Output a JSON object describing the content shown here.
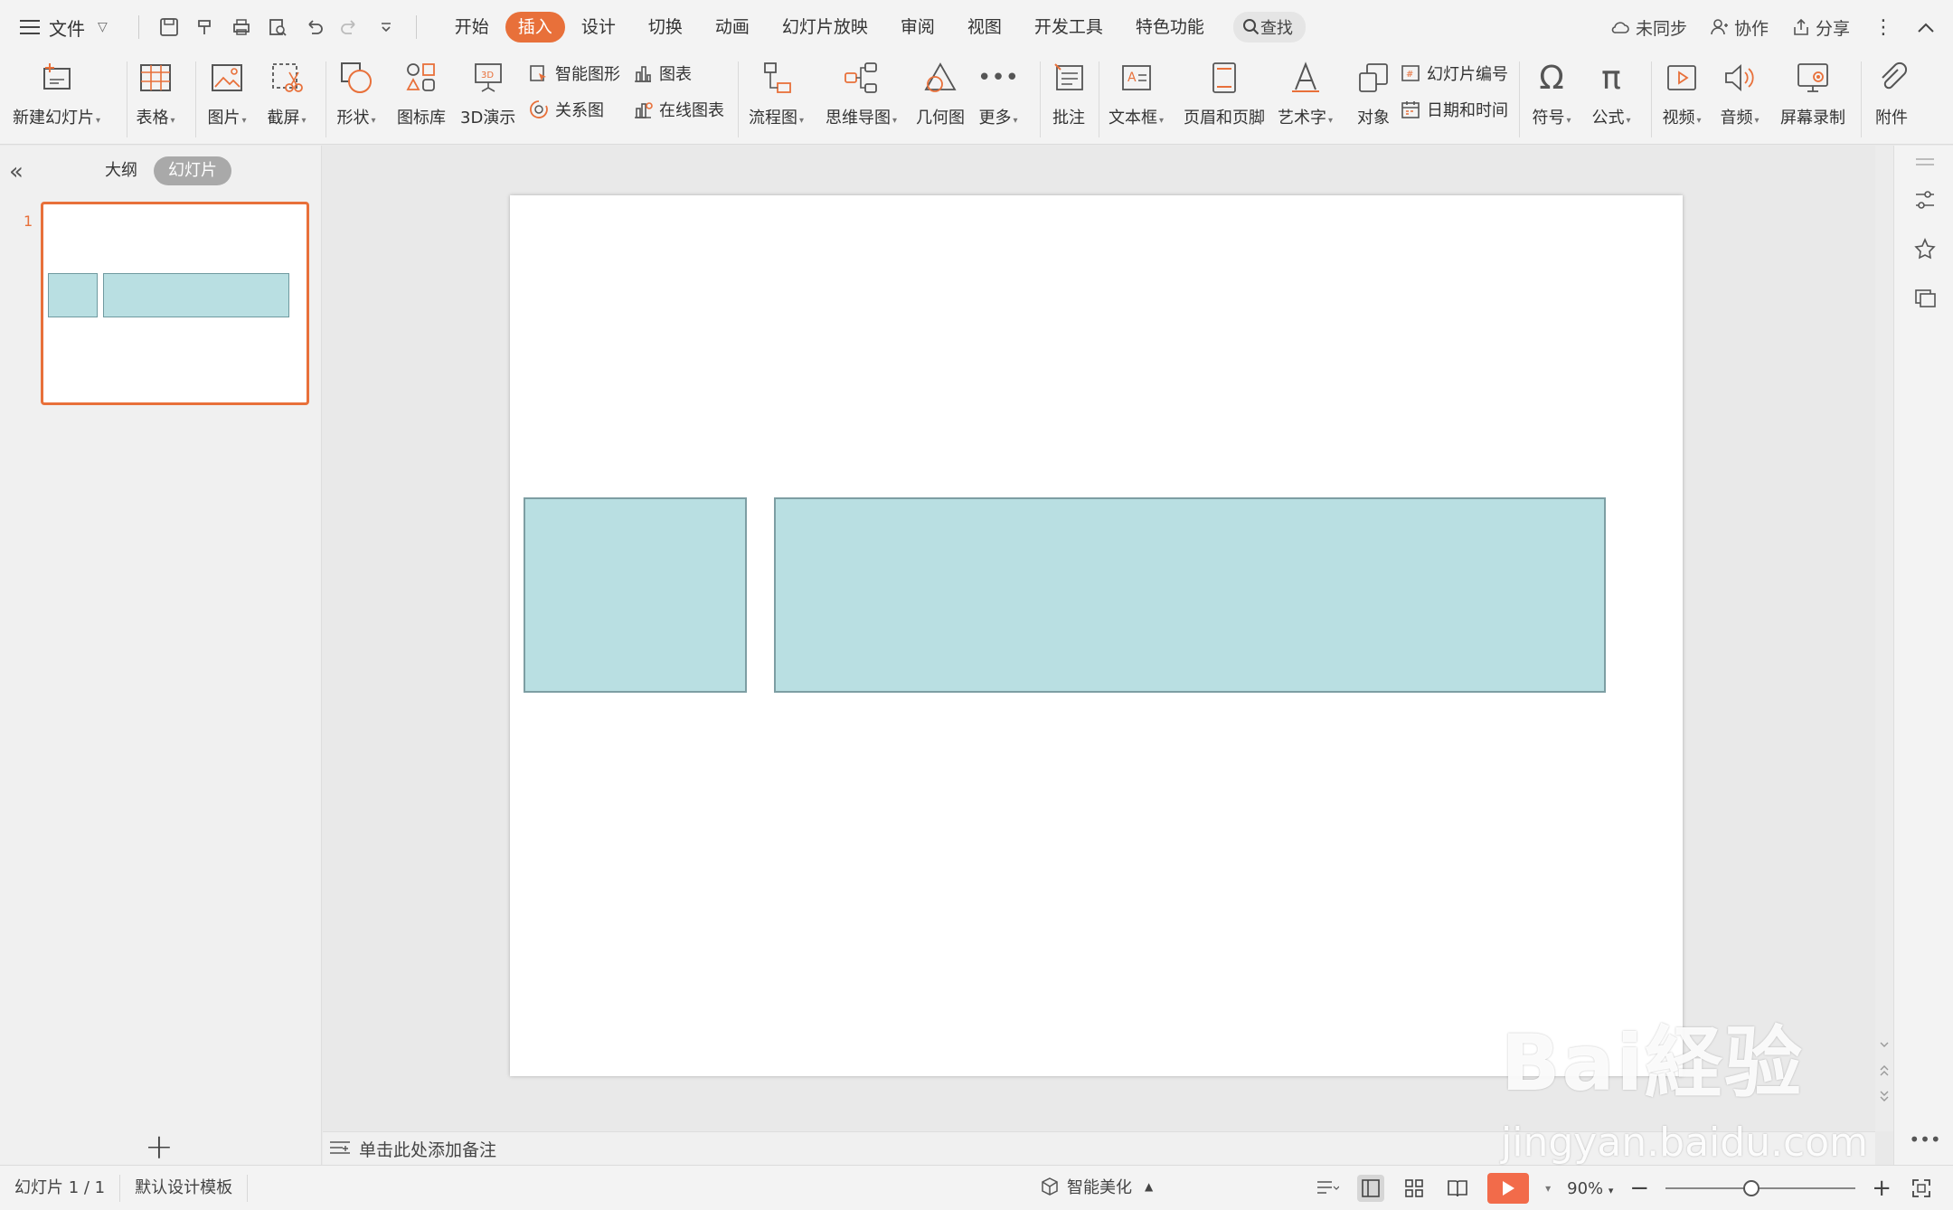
{
  "menubar": {
    "file_label": "文件",
    "tabs": [
      "开始",
      "插入",
      "设计",
      "切换",
      "动画",
      "幻灯片放映",
      "审阅",
      "视图",
      "开发工具",
      "特色功能"
    ],
    "active_tab": "插入",
    "search_label": "查找",
    "right": {
      "sync": "未同步",
      "collab": "协作",
      "share": "分享"
    }
  },
  "ribbon": {
    "new_slide": "新建幻灯片",
    "table": "表格",
    "picture": "图片",
    "screenshot": "截屏",
    "shape": "形状",
    "icon_lib": "图标库",
    "demo3d": "3D演示",
    "smart_shape": "智能图形",
    "chart": "图表",
    "relation": "关系图",
    "online_chart": "在线图表",
    "flowchart": "流程图",
    "mindmap": "思维导图",
    "geometry": "几何图",
    "more": "更多",
    "comment": "批注",
    "textbox": "文本框",
    "header_footer": "页眉和页脚",
    "wordart": "艺术字",
    "object": "对象",
    "slide_number": "幻灯片编号",
    "datetime": "日期和时间",
    "symbol": "符号",
    "formula": "公式",
    "video": "视频",
    "audio": "音频",
    "screen_record": "屏幕录制",
    "attachment": "附件"
  },
  "leftpanel": {
    "outline_tab": "大纲",
    "slides_tab": "幻灯片",
    "slide_number": "1"
  },
  "notes_placeholder": "单击此处添加备注",
  "statusbar": {
    "slide_info": "幻灯片 1 / 1",
    "template": "默认设计模板",
    "smart_beautify": "智能美化",
    "zoom": "90%"
  },
  "watermark": {
    "line1": "Bai経验",
    "line2": "jingyan.baidu.com"
  },
  "colors": {
    "accent": "#e8703a",
    "shape_fill": "#b9dfe2",
    "shape_border": "#7d9ea3",
    "play": "#f26b4a"
  }
}
